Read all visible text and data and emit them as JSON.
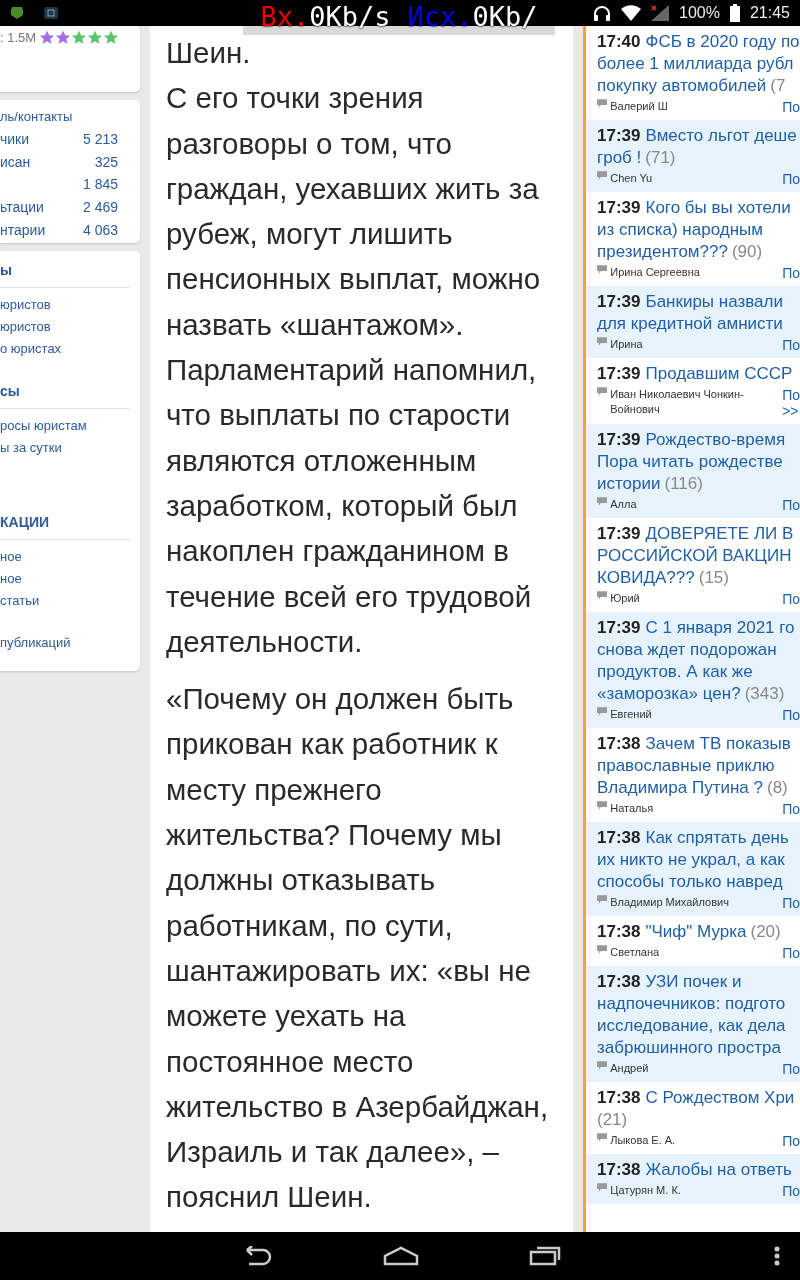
{
  "status_bar": {
    "battery": "100%",
    "time": "21:45"
  },
  "traffic_monitor": {
    "in_label": "Вх.",
    "in_value": "0Kb/s",
    "out_label": "Исх.",
    "out_value": "0Kb/"
  },
  "left_sidebar": {
    "rating": {
      "text": ": 1.5M",
      "stars": [
        {
          "color": "#a56ee6"
        },
        {
          "color": "#a56ee6"
        },
        {
          "color": "#5cc46a"
        },
        {
          "color": "#5cc46a"
        },
        {
          "color": "#5cc46a"
        }
      ]
    },
    "stats": {
      "heading": "ль/контакты",
      "rows": [
        {
          "label": "чики",
          "count": "5 213"
        },
        {
          "label": "исан",
          "count": "325"
        },
        {
          "count": "1 845"
        },
        {
          "label": "ьтации",
          "count": "2 469"
        },
        {
          "label": "нтарии",
          "count": "4 063"
        }
      ]
    },
    "sections": [
      {
        "heading": "ы",
        "links": [
          "юристов",
          "юристов",
          "о юристах"
        ]
      },
      {
        "heading": "сы",
        "links": [
          "росы юристам",
          "ы за сутки"
        ]
      },
      {
        "heading": "КАЦИИ",
        "links": [
          "ное",
          "ное",
          "статьи"
        ]
      }
    ],
    "footer_link": "публикаций"
  },
  "article": {
    "lead_in": "Шеин.",
    "paragraphs": [
      "С его точки зрения разговоры о том, что граждан, уехавших жить за рубеж, могут лишить пенсионных выплат, можно назвать «шантажом». Парламентарий напомнил, что выплаты по старости являются отложенным заработком, который был накоплен гражданином в течение всей его трудовой деятельности.",
      "«Почему он должен быть прикован как работник к месту прежнего жительства? Почему мы должны отказывать работникам, по сути, шантажировать их: «вы не можете уехать на постоянное место жительство в Азербайджан, Израиль и так далее», – пояснил Шеин."
    ]
  },
  "feed": [
    {
      "time": "17:40",
      "lines": [
        "ФСБ в 2020 году по",
        "более 1 миллиарда рубл",
        "покупку автомобилей"
      ],
      "count": "(7",
      "author": "Валерий Ш",
      "reply_lines": [
        "По"
      ]
    },
    {
      "time": "17:39",
      "lines": [
        "Вместо льгот деше",
        "гроб !"
      ],
      "count": "(71)",
      "author": "Chen Yu",
      "reply_lines": [
        "По"
      ]
    },
    {
      "time": "17:39",
      "lines": [
        "Кого бы вы хотели",
        "из списка) народным",
        "президентом???"
      ],
      "count": "(90)",
      "author": "Ирина Сергеевна",
      "reply_lines": [
        "По"
      ]
    },
    {
      "time": "17:39",
      "lines": [
        "Банкиры назвали",
        "для кредитной амнисти"
      ],
      "author": "Ирина",
      "reply_lines": [
        "По"
      ]
    },
    {
      "time": "17:39",
      "lines": [
        "Продавшим СССР"
      ],
      "author": "Иван Николаевич Чонкин-Войнович",
      "reply_lines": [
        "По",
        ">>"
      ]
    },
    {
      "time": "17:39",
      "lines": [
        "Рождество-время",
        "Пора читать рождестве",
        "истории"
      ],
      "count": "(116)",
      "author": "Алла",
      "reply_lines": [
        "По"
      ]
    },
    {
      "time": "17:39",
      "lines": [
        "ДОВЕРЯЕТЕ ЛИ В",
        "РОССИЙСКОЙ ВАКЦИН",
        "КОВИДА???"
      ],
      "count": "(15)",
      "author": "Юрий",
      "reply_lines": [
        "По"
      ]
    },
    {
      "time": "17:39",
      "lines": [
        "С 1 января 2021 го",
        "снова ждет подорожан",
        "продуктов. А как же",
        "«заморозка» цен?"
      ],
      "count": "(343)",
      "author": "Евгений",
      "reply_lines": [
        "По"
      ]
    },
    {
      "time": "17:38",
      "lines": [
        "Зачем ТВ показыв",
        "православные приклю",
        "Владимира Путина ?"
      ],
      "count": "(8)",
      "author": "Наталья",
      "reply_lines": [
        "По"
      ]
    },
    {
      "time": "17:38",
      "lines": [
        "Как спрятать день",
        "их никто не украл, а как",
        "способы только навред"
      ],
      "author": "Владимир Михайлович",
      "reply_lines": [
        "По"
      ]
    },
    {
      "time": "17:38",
      "lines": [
        "\"Чиф\" Мурка"
      ],
      "count": "(20)",
      "author": "Светлана",
      "reply_lines": [
        "По"
      ]
    },
    {
      "time": "17:38",
      "lines": [
        "УЗИ почек и",
        "надпочечников: подгото",
        "исследование, как дела",
        "забрюшинного простра"
      ],
      "author": "Андрей",
      "reply_lines": [
        "По"
      ]
    },
    {
      "time": "17:38",
      "lines": [
        "С Рождеством Хри"
      ],
      "count": "(21)",
      "count_on_new_line": true,
      "author": "Лыкова Е. А.",
      "reply_lines": [
        "По"
      ]
    },
    {
      "time": "17:38",
      "lines": [
        "Жалобы на ответь"
      ],
      "author": "Цатурян М. К.",
      "reply_lines": [
        "По"
      ]
    }
  ]
}
